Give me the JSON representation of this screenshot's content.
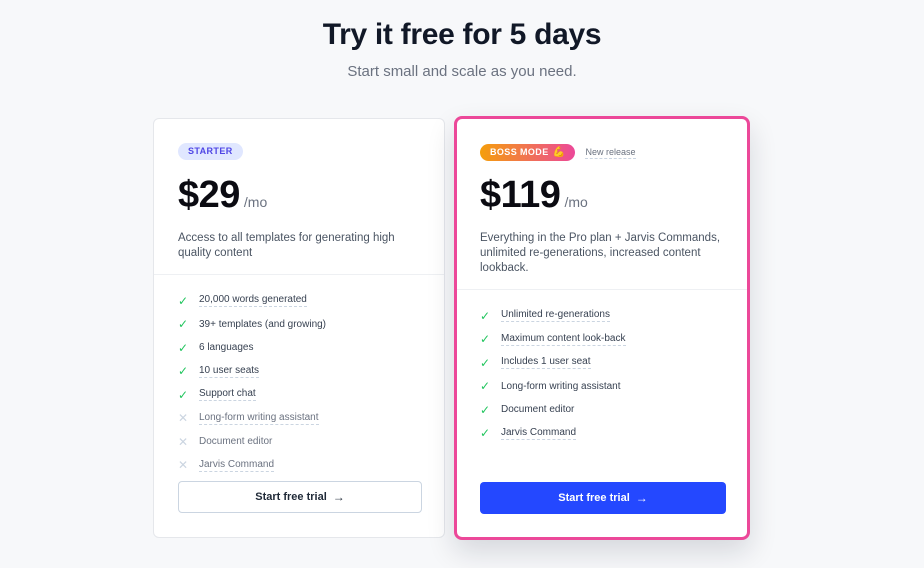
{
  "header": {
    "title": "Try it free for 5 days",
    "subtitle": "Start small and scale as you need."
  },
  "plans": [
    {
      "badge": "STARTER",
      "price": "$29",
      "period": "/mo",
      "description": "Access to all templates for generating high quality content",
      "features": [
        {
          "label": "20,000 words generated",
          "included": true
        },
        {
          "label": "39+ templates (and growing)",
          "included": true
        },
        {
          "label": "6 languages",
          "included": true
        },
        {
          "label": "10 user seats",
          "included": true
        },
        {
          "label": "Support chat",
          "included": true
        },
        {
          "label": "Long-form writing assistant",
          "included": false
        },
        {
          "label": "Document editor",
          "included": false
        },
        {
          "label": "Jarvis Command",
          "included": false
        }
      ],
      "cta": "Start free trial",
      "cta_arrow": "→"
    },
    {
      "badge": "BOSS MODE",
      "badge_icon": "💪",
      "tag": "New release",
      "price": "$119",
      "period": "/mo",
      "description": "Everything in the Pro plan + Jarvis Commands, unlimited re-generations, increased content lookback.",
      "features": [
        {
          "label": "Unlimited re-generations",
          "included": true
        },
        {
          "label": "Maximum content look-back",
          "included": true
        },
        {
          "label": "Includes 1 user seat",
          "included": true
        },
        {
          "label": "Long-form writing assistant",
          "included": true
        },
        {
          "label": "Document editor",
          "included": true
        },
        {
          "label": "Jarvis Command",
          "included": true
        }
      ],
      "cta": "Start free trial",
      "cta_arrow": "→"
    }
  ],
  "icons": {
    "check": "✓",
    "cross": "✕"
  },
  "colors": {
    "accent_blue": "#2448ff",
    "highlight_pink": "#ec4899",
    "check_green": "#22c55e",
    "starter_badge_bg": "#e0e7ff",
    "starter_badge_text": "#4f46e5"
  }
}
